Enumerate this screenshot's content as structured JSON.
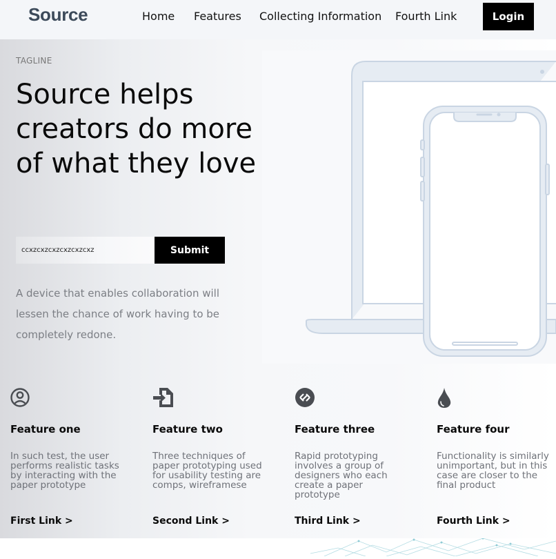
{
  "header": {
    "logo": "Source",
    "nav": [
      "Home",
      "Features",
      "Collecting Information",
      "Fourth Link"
    ],
    "login_label": "Login"
  },
  "hero": {
    "tagline": "TAGLINE",
    "headline": "Source helps creators do more of what they love",
    "input_value": "ccxzcxzcxzcxzcxzcxz",
    "submit_label": "Submit",
    "description": "A device that enables collaboration will lessen the chance of work having to be completely redone."
  },
  "features": [
    {
      "icon": "user-circle-icon",
      "title": "Feature one",
      "text": "In such test, the user performs realistic tasks by interacting with the paper prototype",
      "link": "First Link >"
    },
    {
      "icon": "file-import-icon",
      "title": "Feature two",
      "text": "Three techniques of paper prototyping used for usability testing are comps, wireframese",
      "link": "Second Link >"
    },
    {
      "icon": "link-circle-icon",
      "title": "Feature three",
      "text": "Rapid prototyping involves a group of designers who each create a paper prototype",
      "link": "Third Link >"
    },
    {
      "icon": "water-drop-icon",
      "title": "Feature four",
      "text": "Functionality is similarly unimportant, but in this case are closer to the final product",
      "link": "Fourth Link >"
    }
  ],
  "colors": {
    "accent": "#000000",
    "logo": "#3c4a5a",
    "device_stroke": "#c9d5e3",
    "icon": "#4a4d52"
  }
}
